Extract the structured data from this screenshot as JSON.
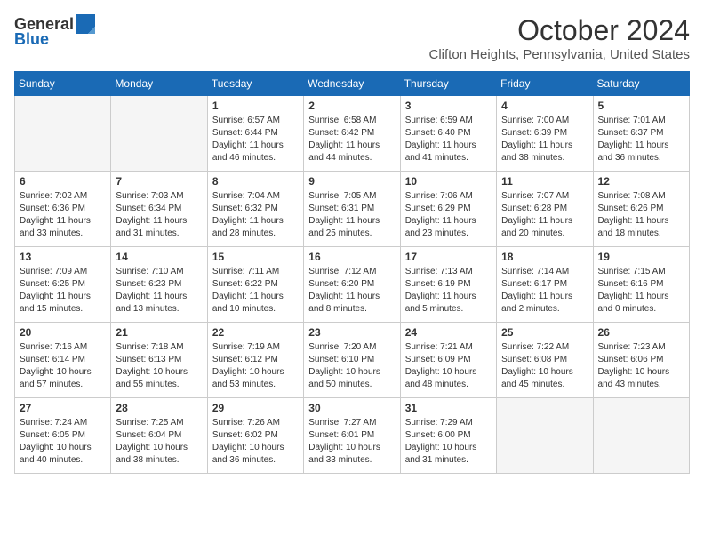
{
  "header": {
    "logo_general": "General",
    "logo_blue": "Blue",
    "month_title": "October 2024",
    "location": "Clifton Heights, Pennsylvania, United States"
  },
  "weekdays": [
    "Sunday",
    "Monday",
    "Tuesday",
    "Wednesday",
    "Thursday",
    "Friday",
    "Saturday"
  ],
  "weeks": [
    [
      {
        "day": "",
        "empty": true
      },
      {
        "day": "",
        "empty": true
      },
      {
        "day": "1",
        "sunrise": "Sunrise: 6:57 AM",
        "sunset": "Sunset: 6:44 PM",
        "daylight": "Daylight: 11 hours and 46 minutes."
      },
      {
        "day": "2",
        "sunrise": "Sunrise: 6:58 AM",
        "sunset": "Sunset: 6:42 PM",
        "daylight": "Daylight: 11 hours and 44 minutes."
      },
      {
        "day": "3",
        "sunrise": "Sunrise: 6:59 AM",
        "sunset": "Sunset: 6:40 PM",
        "daylight": "Daylight: 11 hours and 41 minutes."
      },
      {
        "day": "4",
        "sunrise": "Sunrise: 7:00 AM",
        "sunset": "Sunset: 6:39 PM",
        "daylight": "Daylight: 11 hours and 38 minutes."
      },
      {
        "day": "5",
        "sunrise": "Sunrise: 7:01 AM",
        "sunset": "Sunset: 6:37 PM",
        "daylight": "Daylight: 11 hours and 36 minutes."
      }
    ],
    [
      {
        "day": "6",
        "sunrise": "Sunrise: 7:02 AM",
        "sunset": "Sunset: 6:36 PM",
        "daylight": "Daylight: 11 hours and 33 minutes."
      },
      {
        "day": "7",
        "sunrise": "Sunrise: 7:03 AM",
        "sunset": "Sunset: 6:34 PM",
        "daylight": "Daylight: 11 hours and 31 minutes."
      },
      {
        "day": "8",
        "sunrise": "Sunrise: 7:04 AM",
        "sunset": "Sunset: 6:32 PM",
        "daylight": "Daylight: 11 hours and 28 minutes."
      },
      {
        "day": "9",
        "sunrise": "Sunrise: 7:05 AM",
        "sunset": "Sunset: 6:31 PM",
        "daylight": "Daylight: 11 hours and 25 minutes."
      },
      {
        "day": "10",
        "sunrise": "Sunrise: 7:06 AM",
        "sunset": "Sunset: 6:29 PM",
        "daylight": "Daylight: 11 hours and 23 minutes."
      },
      {
        "day": "11",
        "sunrise": "Sunrise: 7:07 AM",
        "sunset": "Sunset: 6:28 PM",
        "daylight": "Daylight: 11 hours and 20 minutes."
      },
      {
        "day": "12",
        "sunrise": "Sunrise: 7:08 AM",
        "sunset": "Sunset: 6:26 PM",
        "daylight": "Daylight: 11 hours and 18 minutes."
      }
    ],
    [
      {
        "day": "13",
        "sunrise": "Sunrise: 7:09 AM",
        "sunset": "Sunset: 6:25 PM",
        "daylight": "Daylight: 11 hours and 15 minutes."
      },
      {
        "day": "14",
        "sunrise": "Sunrise: 7:10 AM",
        "sunset": "Sunset: 6:23 PM",
        "daylight": "Daylight: 11 hours and 13 minutes."
      },
      {
        "day": "15",
        "sunrise": "Sunrise: 7:11 AM",
        "sunset": "Sunset: 6:22 PM",
        "daylight": "Daylight: 11 hours and 10 minutes."
      },
      {
        "day": "16",
        "sunrise": "Sunrise: 7:12 AM",
        "sunset": "Sunset: 6:20 PM",
        "daylight": "Daylight: 11 hours and 8 minutes."
      },
      {
        "day": "17",
        "sunrise": "Sunrise: 7:13 AM",
        "sunset": "Sunset: 6:19 PM",
        "daylight": "Daylight: 11 hours and 5 minutes."
      },
      {
        "day": "18",
        "sunrise": "Sunrise: 7:14 AM",
        "sunset": "Sunset: 6:17 PM",
        "daylight": "Daylight: 11 hours and 2 minutes."
      },
      {
        "day": "19",
        "sunrise": "Sunrise: 7:15 AM",
        "sunset": "Sunset: 6:16 PM",
        "daylight": "Daylight: 11 hours and 0 minutes."
      }
    ],
    [
      {
        "day": "20",
        "sunrise": "Sunrise: 7:16 AM",
        "sunset": "Sunset: 6:14 PM",
        "daylight": "Daylight: 10 hours and 57 minutes."
      },
      {
        "day": "21",
        "sunrise": "Sunrise: 7:18 AM",
        "sunset": "Sunset: 6:13 PM",
        "daylight": "Daylight: 10 hours and 55 minutes."
      },
      {
        "day": "22",
        "sunrise": "Sunrise: 7:19 AM",
        "sunset": "Sunset: 6:12 PM",
        "daylight": "Daylight: 10 hours and 53 minutes."
      },
      {
        "day": "23",
        "sunrise": "Sunrise: 7:20 AM",
        "sunset": "Sunset: 6:10 PM",
        "daylight": "Daylight: 10 hours and 50 minutes."
      },
      {
        "day": "24",
        "sunrise": "Sunrise: 7:21 AM",
        "sunset": "Sunset: 6:09 PM",
        "daylight": "Daylight: 10 hours and 48 minutes."
      },
      {
        "day": "25",
        "sunrise": "Sunrise: 7:22 AM",
        "sunset": "Sunset: 6:08 PM",
        "daylight": "Daylight: 10 hours and 45 minutes."
      },
      {
        "day": "26",
        "sunrise": "Sunrise: 7:23 AM",
        "sunset": "Sunset: 6:06 PM",
        "daylight": "Daylight: 10 hours and 43 minutes."
      }
    ],
    [
      {
        "day": "27",
        "sunrise": "Sunrise: 7:24 AM",
        "sunset": "Sunset: 6:05 PM",
        "daylight": "Daylight: 10 hours and 40 minutes."
      },
      {
        "day": "28",
        "sunrise": "Sunrise: 7:25 AM",
        "sunset": "Sunset: 6:04 PM",
        "daylight": "Daylight: 10 hours and 38 minutes."
      },
      {
        "day": "29",
        "sunrise": "Sunrise: 7:26 AM",
        "sunset": "Sunset: 6:02 PM",
        "daylight": "Daylight: 10 hours and 36 minutes."
      },
      {
        "day": "30",
        "sunrise": "Sunrise: 7:27 AM",
        "sunset": "Sunset: 6:01 PM",
        "daylight": "Daylight: 10 hours and 33 minutes."
      },
      {
        "day": "31",
        "sunrise": "Sunrise: 7:29 AM",
        "sunset": "Sunset: 6:00 PM",
        "daylight": "Daylight: 10 hours and 31 minutes."
      },
      {
        "day": "",
        "empty": true
      },
      {
        "day": "",
        "empty": true
      }
    ]
  ]
}
